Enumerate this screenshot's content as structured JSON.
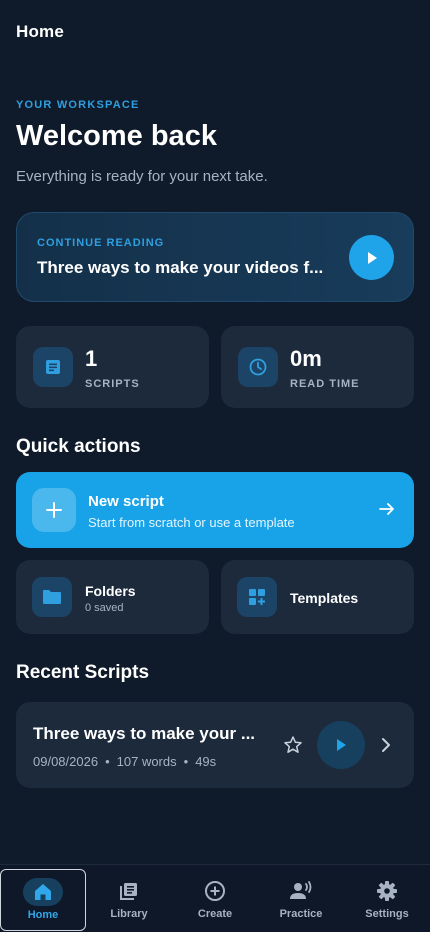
{
  "header": {
    "title": "Home"
  },
  "hero": {
    "eyebrow": "YOUR WORKSPACE",
    "title": "Welcome back",
    "subtitle": "Everything is ready for your next take."
  },
  "continue_reading": {
    "eyebrow": "CONTINUE READING",
    "title": "Three ways to make your videos f..."
  },
  "stats": [
    {
      "value": "1",
      "label": "SCRIPTS",
      "icon": "document-icon"
    },
    {
      "value": "0m",
      "label": "READ TIME",
      "icon": "clock-icon"
    }
  ],
  "quick_actions": {
    "title": "Quick actions",
    "new_script": {
      "title": "New script",
      "subtitle": "Start from scratch or use a template"
    },
    "folders": {
      "title": "Folders",
      "subtitle": "0 saved"
    },
    "templates": {
      "title": "Templates"
    }
  },
  "recent": {
    "title": "Recent Scripts",
    "items": [
      {
        "title": "Three ways to make your ...",
        "date": "09/08/2026",
        "words": "107 words",
        "duration": "49s"
      }
    ]
  },
  "nav": [
    {
      "label": "Home",
      "icon": "home-icon",
      "active": true
    },
    {
      "label": "Library",
      "icon": "library-icon"
    },
    {
      "label": "Create",
      "icon": "add-circle-icon"
    },
    {
      "label": "Practice",
      "icon": "practice-icon"
    },
    {
      "label": "Settings",
      "icon": "gear-icon"
    }
  ],
  "colors": {
    "background": "#0f1a2a",
    "accent": "#18a3e8",
    "card": "#1c2a3c"
  }
}
